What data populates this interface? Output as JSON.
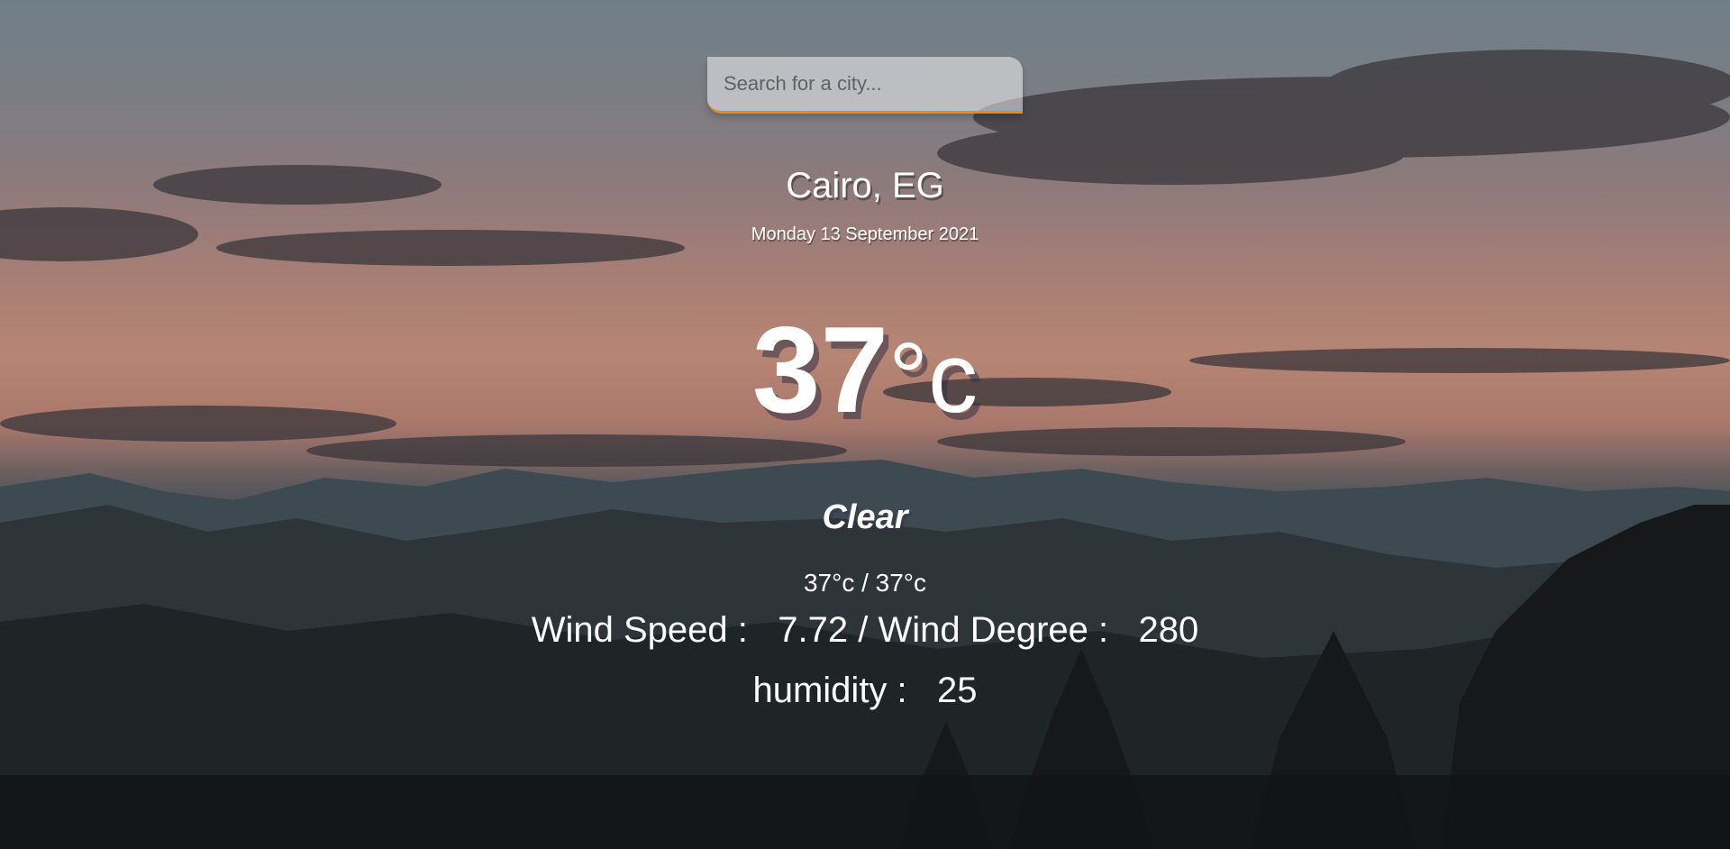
{
  "search": {
    "placeholder": "Search for a city...",
    "value": ""
  },
  "location": {
    "city_country": "Cairo, EG",
    "date": "Monday 13 September 2021"
  },
  "current": {
    "temperature": "37",
    "unit": "°c",
    "weather": "Clear",
    "hi_low": "37°c / 37°c"
  },
  "details": {
    "wind_speed_label": "Wind Speed :",
    "wind_speed_value": "7.72",
    "separator": "/",
    "wind_degree_label": "Wind Degree :",
    "wind_degree_value": "280",
    "humidity_label": "humidity :",
    "humidity_value": "25"
  },
  "colors": {
    "accent": "#df8e1d",
    "text": "#ffffff"
  }
}
